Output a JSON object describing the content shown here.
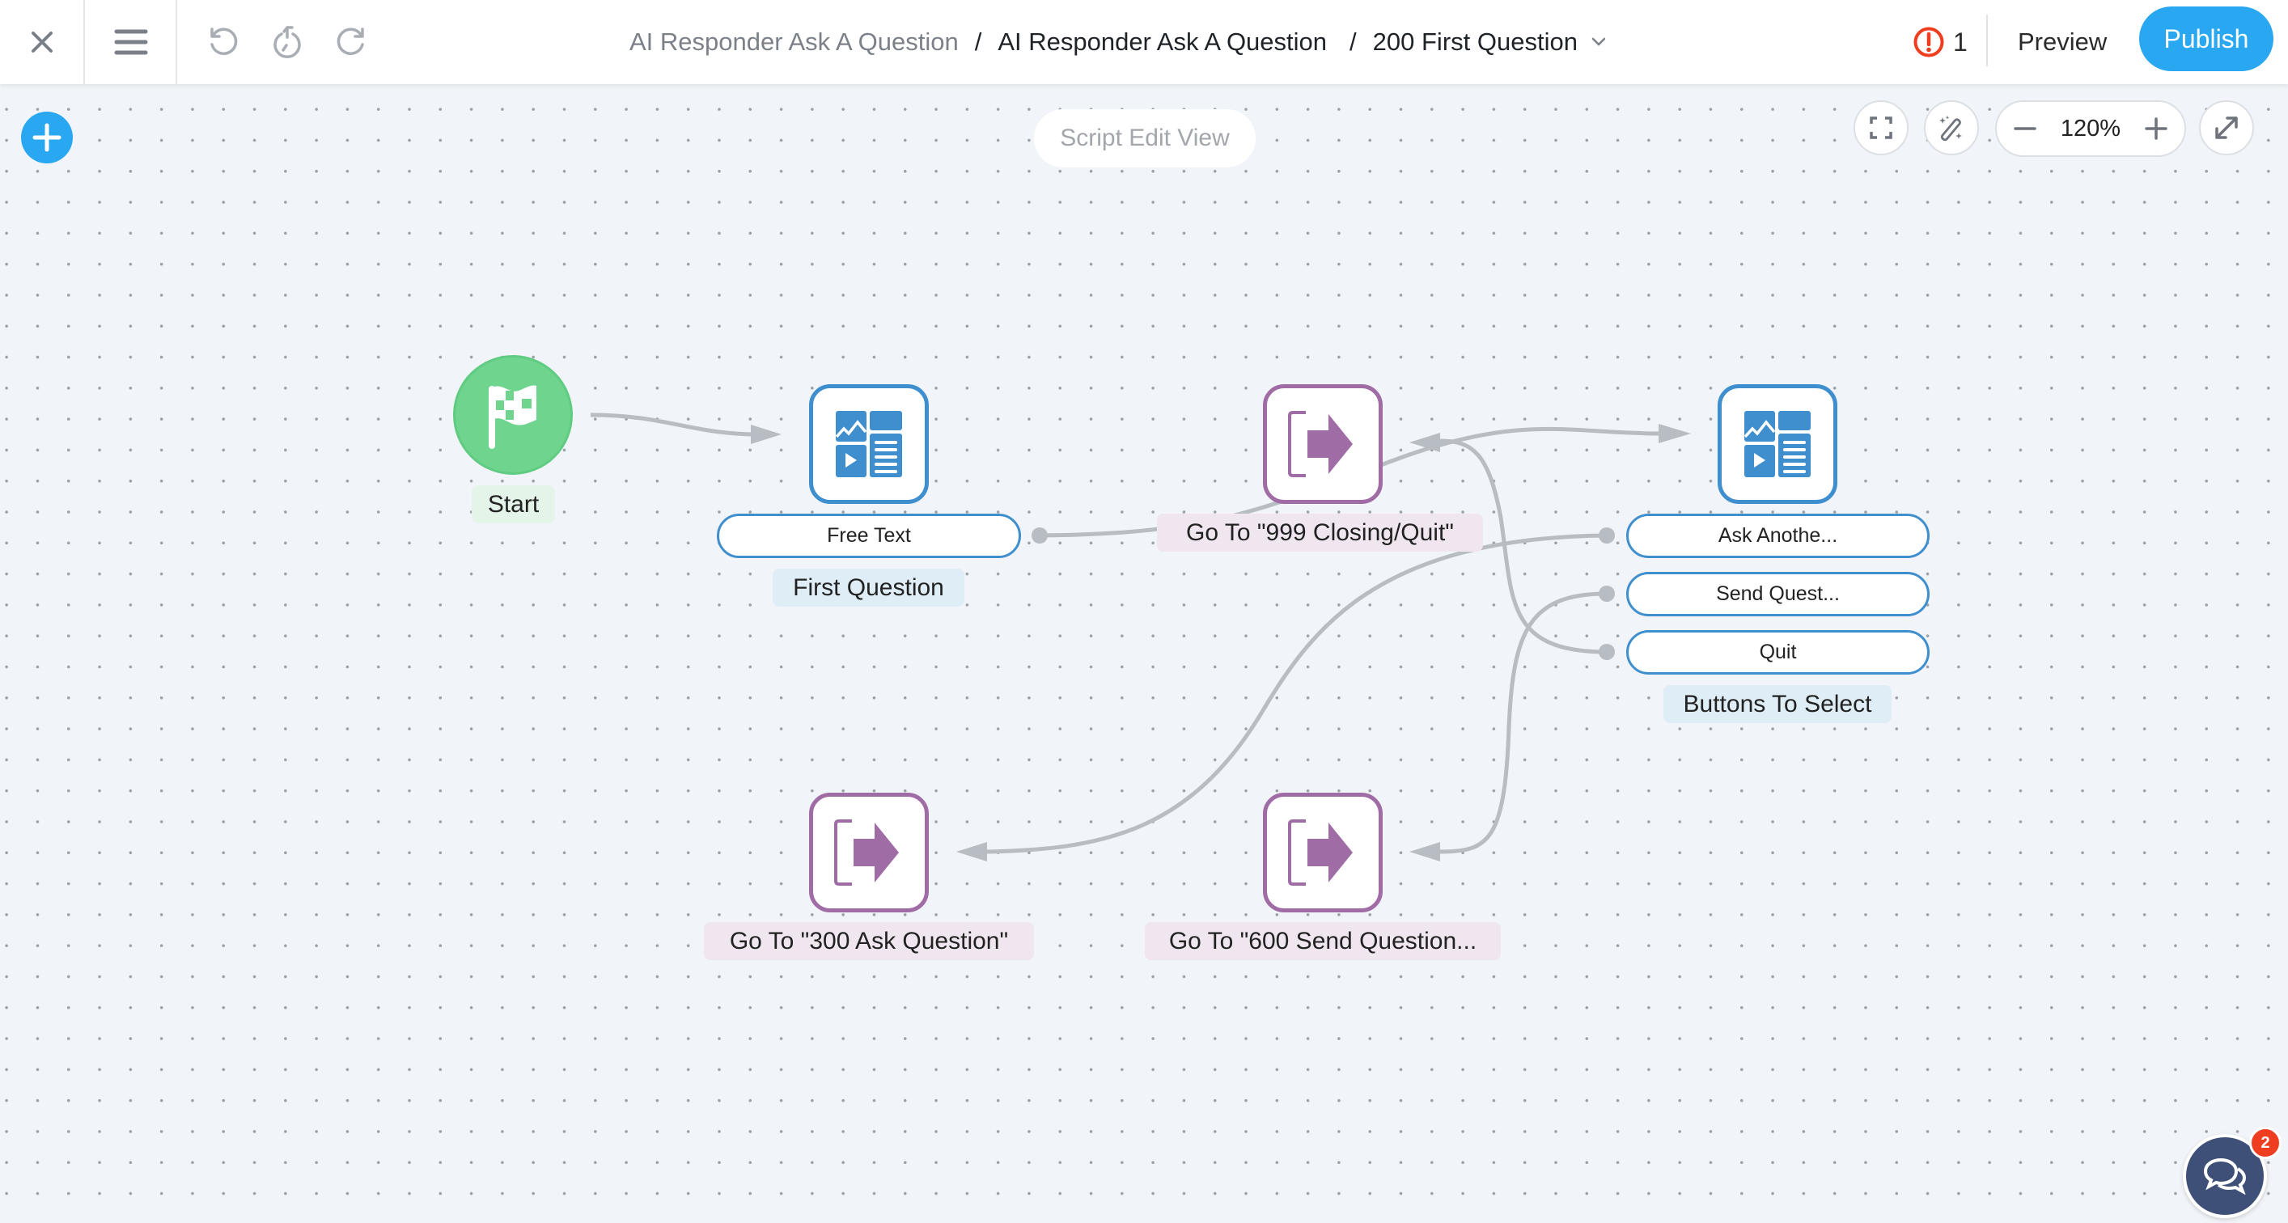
{
  "header": {
    "close_icon": "close-icon",
    "menu_icon": "hamburger-menu-icon",
    "undo_icon": "undo-icon",
    "history_icon": "history-reset-icon",
    "redo_icon": "redo-icon",
    "breadcrumb": [
      {
        "label": "AI Responder Ask A Question",
        "muted": true
      },
      {
        "label": "AI Responder Ask A Question",
        "muted": false
      },
      {
        "label": "200 First Question",
        "muted": false
      }
    ],
    "breadcrumb_separator": "/",
    "alert_count": "1",
    "preview_label": "Preview",
    "publish_label": "Publish"
  },
  "canvas": {
    "view_label": "Script Edit View",
    "zoom_level": "120%",
    "controls": [
      "fit-screen-icon",
      "magic-wand-icon",
      "zoom-out-icon",
      "zoom-in-icon",
      "expand-icon"
    ]
  },
  "nodes": {
    "start": {
      "label": "Start",
      "icon": "checkered-flag-icon"
    },
    "first_question": {
      "label": "First Question",
      "icon": "content-block-icon",
      "options": [
        "Free Text"
      ]
    },
    "goto_999": {
      "label": "Go To \"999 Closing/Quit\"",
      "icon": "goto-exit-icon"
    },
    "buttons_to_select": {
      "label": "Buttons To Select",
      "icon": "content-block-icon",
      "options": [
        "Ask Anothe...",
        "Send Quest...",
        "Quit"
      ]
    },
    "goto_300": {
      "label": "Go To \"300 Ask Question\"",
      "icon": "goto-exit-icon"
    },
    "goto_600": {
      "label": "Go To \"600 Send Question...",
      "icon": "goto-exit-icon"
    }
  },
  "chat": {
    "badge_count": "2"
  },
  "colors": {
    "accent": "#29a7f0",
    "node_blue": "#3f8fcf",
    "node_purple": "#a06ca6",
    "start_green": "#6ed48e",
    "alert_red": "#ef3e1f",
    "edge_gray": "#b8bcc3"
  }
}
